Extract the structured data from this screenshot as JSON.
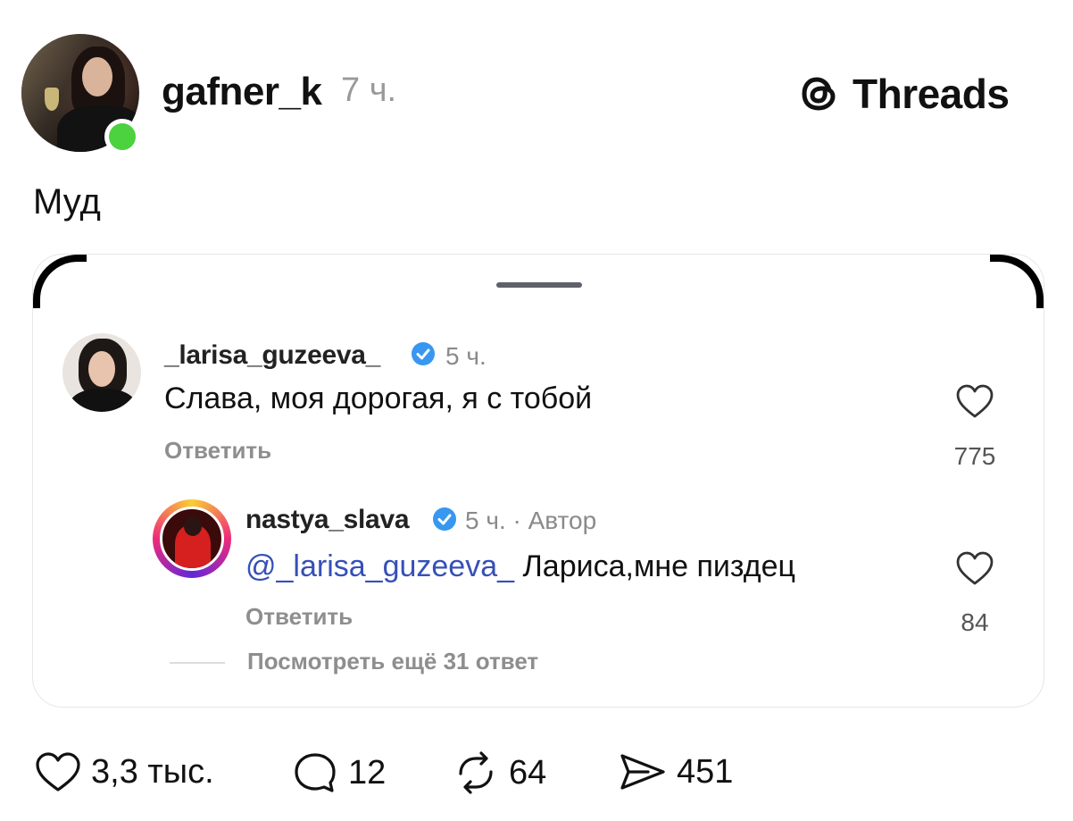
{
  "post": {
    "username": "gafner_k",
    "time": "7 ч.",
    "text": "Муд",
    "brand": "Threads"
  },
  "embedded": {
    "comment1": {
      "username": "_larisa_guzeeva_",
      "time": "5 ч.",
      "text": "Слава, моя дорогая, я с тобой",
      "reply_label": "Ответить",
      "likes": "775"
    },
    "comment2": {
      "username": "nastya_slava",
      "time": "5 ч. · Автор",
      "mention": "@_larisa_guzeeva_",
      "text": " Лариса,мне пиздец",
      "reply_label": "Ответить",
      "likes": "84"
    },
    "more_replies": "Посмотреть ещё 31 ответ"
  },
  "actions": {
    "likes": "3,3 тыс.",
    "comments": "12",
    "reposts": "64",
    "shares": "451"
  },
  "colors": {
    "online": "#4cd13f",
    "verified": "#3897f0",
    "mention": "#3650b8"
  }
}
